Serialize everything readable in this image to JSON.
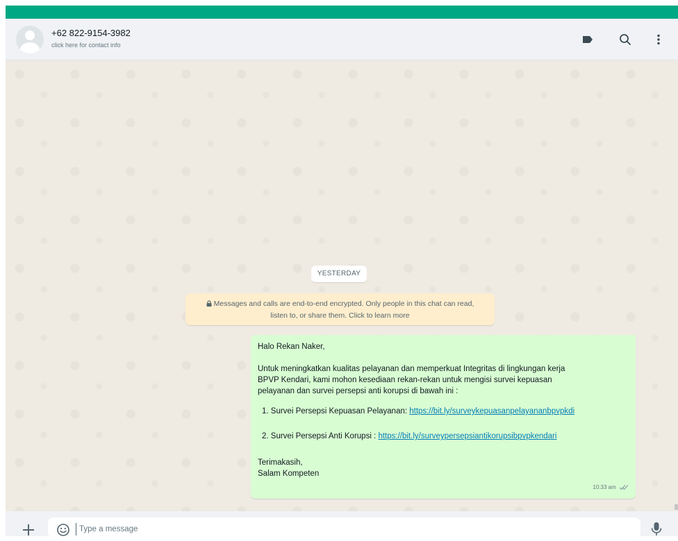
{
  "contact": {
    "phone": "+62 822-9154-3982",
    "subtitle": "click here for contact info"
  },
  "header_icons": [
    "label-icon",
    "search-icon",
    "menu-icon"
  ],
  "chat": {
    "date_label": "YESTERDAY",
    "encryption_line1": "Messages and calls are end-to-end encrypted. Only people in this chat can read,",
    "encryption_line2": "listen to, or share them. Click to learn more",
    "message": {
      "greeting": "Halo Rekan Naker,",
      "body_line1": "Untuk meningkatkan kualitas pelayanan dan memperkuat Integritas di lingkungan kerja",
      "body_line2": "BPVP Kendari, kami mohon kesediaan rekan-rekan untuk mengisi survei kepuasan",
      "body_line3": "pelayanan dan survei persepsi anti korupsi di bawah ini :",
      "item1_text": "1. Survei Persepsi Kepuasan Pelayanan: ",
      "item1_link": "https://bit.ly/surveykepuasanpelayananbpvpkdi",
      "item2_text": "2. Survei Persepsi Anti Korupsi : ",
      "item2_link": "https://bit.ly/surveypersepsiantikorupsibpvpkendari",
      "closing1": "Terimakasih,",
      "closing2": "Salam Kompeten",
      "time": "10:33 am"
    }
  },
  "footer": {
    "placeholder": "Type a message"
  },
  "colors": {
    "accent": "#00a884",
    "bubble_out": "#d9fdd3",
    "notice": "#ffeecd",
    "link": "#027eb5"
  }
}
